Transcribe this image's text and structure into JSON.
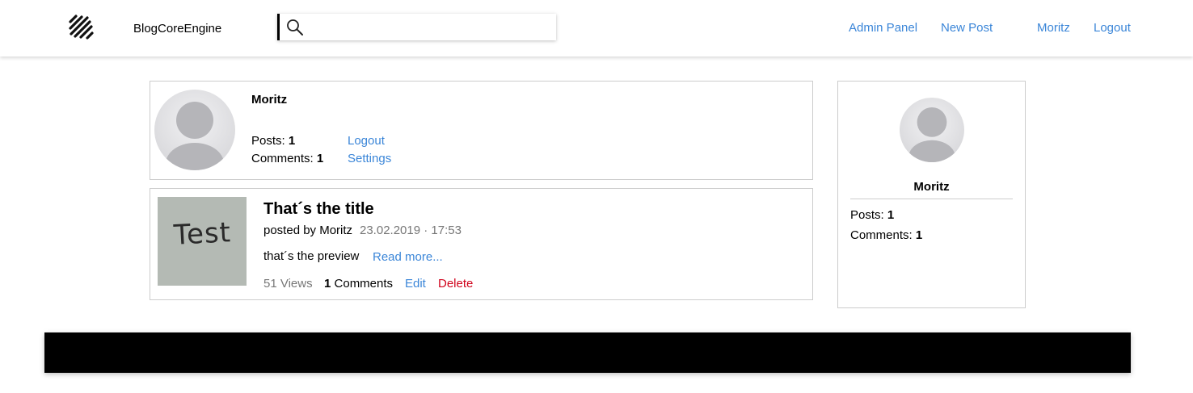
{
  "navbar": {
    "logo_icon": "diagonal-stripes-logo",
    "brand": "BlogCoreEngine",
    "search": {
      "placeholder": "",
      "value": "",
      "icon": "search-icon"
    },
    "links": {
      "admin_panel": "Admin Panel",
      "new_post": "New Post",
      "user": "Moritz",
      "logout": "Logout"
    }
  },
  "profile": {
    "name": "Moritz",
    "posts_label": "Posts:",
    "posts_count": "1",
    "comments_label": "Comments:",
    "comments_count": "1",
    "logout": "Logout",
    "settings": "Settings"
  },
  "post": {
    "thumbnail_text": "Test",
    "title": "That´s the title",
    "posted_by": "posted by Moritz",
    "date": "23.02.2019 · 17:53",
    "preview": "that´s the preview",
    "read_more": "Read more...",
    "views": "51 Views",
    "comments_count": "1",
    "comments_label": "Comments",
    "edit": "Edit",
    "delete": "Delete"
  },
  "sidebar": {
    "name": "Moritz",
    "posts_label": "Posts:",
    "posts_count": "1",
    "comments_label": "Comments:",
    "comments_count": "1"
  },
  "colors": {
    "link": "#3b86d8",
    "delete": "#d0021b",
    "footer": "#000000",
    "thumbnail_bg": "#b4bab4"
  }
}
